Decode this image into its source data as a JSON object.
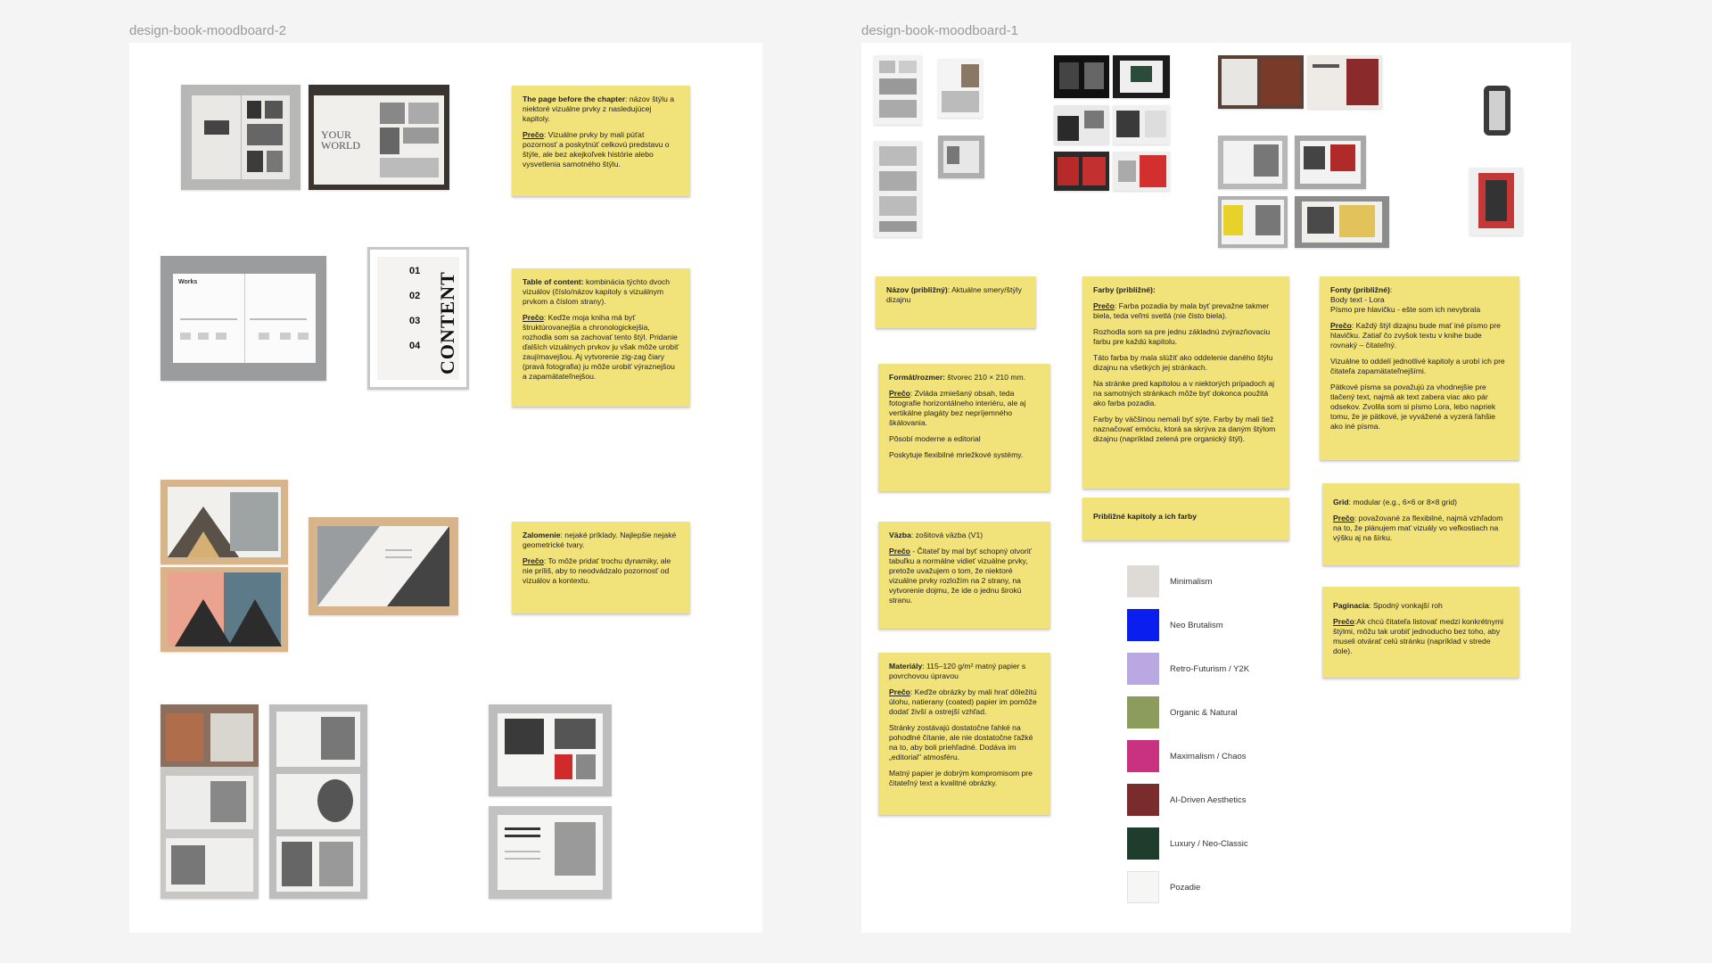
{
  "canvas": {
    "frame_left_title": "design-book-moodboard-2",
    "frame_right_title": "design-book-moodboard-1"
  },
  "left_notes": {
    "chapter": {
      "title": "The page before the chapter",
      "text": ": názov štýlu a niektoré vizuálne prvky z nasledujúcej kapitoly.",
      "why_label": "Prečo",
      "why_text": ": Vizuálne prvky by mali púťat pozornosť a poskytnúť celkovú predstavu o štýle, ale bez akejkoľvek histórie alebo vysvetlenia samotného štýlu."
    },
    "toc": {
      "title": "Table of content:",
      "text": " kombinácia týchto dvoch vizuálov (číslo/názov kapitoly s vizuálnym prvkom a číslom strany).",
      "why_label": "Prečo",
      "why_text": ": Keďže moja kniha má byť štruktúrovanejšia a chronologickejšia, rozhodla som sa zachovať tento štýl. Pridanie ďalších vizuálnych prvkov ju však môže urobiť zaujímavejšou. Aj vytvorenie zig-zag čiary (pravá fotografia) ju môže urobiť výraznejšou a zapamätateľnejšou."
    },
    "fold": {
      "title": "Zalomenie",
      "text": ": nejaké príklady. Najlepšie nejaké geometrické tvary.",
      "why_label": "Prečo",
      "why_text": ": To môže pridať trochu dynamiky, ale nie príliš, aby to neodvádzalo pozornosť od vizuálov a kontextu."
    }
  },
  "right_notes": {
    "name": {
      "title": "Názov (približný)",
      "text": ": Aktuálne smery/štýly dizajnu"
    },
    "format": {
      "title": "Formát/rozmer:",
      "text": " štvorec 210 × 210 mm.",
      "why_label": "Prečo",
      "why_text": ": Zvláda zmiešaný obsah, teda fotografie horizontálneho interiéru, ale aj vertikálne plagáty bez nepríjemného škálovania.",
      "p2": "Pôsobí moderne a editorial",
      "p3": "Poskytuje flexibilné mriežkové systémy."
    },
    "binding": {
      "title": "Väzba",
      "text": ": zošitová väzba (V1)",
      "why_label": "Prečo",
      "why_text": " - Čitateľ by mal byť schopný otvoriť tabuľku a normálne vidieť vizuálne prvky, pretože uvažujem o tom, že niektoré vizuálne prvky rozložím na 2 strany, na vytvorenie dojmu, že ide o jednu širokú stranu."
    },
    "materials": {
      "title": "Materiály",
      "text": ": 115–120 g/m² matný papier s povrchovou úpravou",
      "why_label": "Prečo",
      "why_text": ": Keďže obrázky by mali hrať dôležitú úlohu, natierany (coated) papier im pomôže dodať živší a ostrejší vzhľad.",
      "p2": "Stránky zostávajú dostatočne ľahké na pohodlné čítanie, ale nie dostatočne ťažké na to, aby boli priehľadné. Dodáva im „editorial\" atmosféru.",
      "p3": "Matný papier je dobrým kompromisom pre čitateľný text a kvalitné obrázky."
    },
    "colors": {
      "title": "Farby (približné):",
      "why_label": "Prečo",
      "why_text": ": Farba pozadia by mala byť prevažne takmer biela, teda veľmi svetlá (nie čisto biela).",
      "p2": "Rozhodla som sa pre jednu základnú zvýrazňovaciu farbu pre každú kapitolu.",
      "p3": "Táto farba by mala slúžiť ako oddelenie daného štýlu dizajnu na všetkých jej stránkach.",
      "p4": "Na stránke pred kapitolou a v niektorých prípadoch aj na samotných stránkach môže byť dokonca použitá ako farba pozadia.",
      "p5": "Farby by väčšinou nemali byť sýte. Farby by mali tiež naznačovať emóciu, ktorá sa skrýva za daným štýlom dizajnu (napríklad zelená pre organický štýl)."
    },
    "chapters_colors": {
      "title": "Približné kapitoly a ich farby"
    },
    "fonts": {
      "title": "Fonty (približné)",
      "line1": "Body text - Lora",
      "line2": "Písmo pre hlavičku - ešte som ich nevybrala",
      "why_label": "Prečo",
      "why_text": ": Každý štýl dizajnu bude mať iné písmo pre hlavičku. Zatiaľ čo zvyšok textu v knihe bude rovnaký – čitateľný.",
      "p2": "Vizuálne to oddelí jednotlivé kapitoly a urobí ich pre čitateľa zapamätateľnejšími.",
      "p3": "Pätkové písma sa považujú za vhodnejšie pre tlačený text, najmä ak text zabera viac ako pár odsekov. Zvolila som si písmo Lora, lebo napriek tomu, že je pätkové, je vyvážené a vyzerá ľahšie ako iné písma."
    },
    "grid": {
      "title": "Grid",
      "text": ": modular (e.g., 6×6 or 8×8 grid)",
      "why_label": "Prečo",
      "why_text": ": považované za flexibilné, najmä vzhľadom na to, že plánujem mať vizuály vo veľkostiach na výšku aj na šírku."
    },
    "pagination": {
      "title": "Paginacia",
      "text": ": Spodný vonkajší roh",
      "why_label": "Prečo",
      "why_text": ":Ak chcú čitateľa listovať medzi konkrétnymi štýlmi, môžu tak urobiť jednoducho bez toho, aby museli otvárať celú stránku (napríklad v strede dole)."
    }
  },
  "swatches": [
    {
      "label": "Minimalism",
      "color": "#dedbd6"
    },
    {
      "label": "Neo Brutalism",
      "color": "#0a1ef0"
    },
    {
      "label": "Retro-Futurism / Y2K",
      "color": "#b9a8e2"
    },
    {
      "label": "Organic & Natural",
      "color": "#8c9c5c"
    },
    {
      "label": "Maximalism / Chaos",
      "color": "#c8327e"
    },
    {
      "label": "AI-Driven Aesthetics",
      "color": "#7a2c2c"
    },
    {
      "label": "Luxury / Neo-Classic",
      "color": "#1f3d2c"
    },
    {
      "label": "Pozadie",
      "color": "#f6f6f4"
    }
  ],
  "image_text": {
    "toc_heading": "CONTENT",
    "toc_num_1": "01",
    "toc_num_2": "02",
    "toc_num_3": "03",
    "toc_num_4": "04",
    "works_title": "Works",
    "book_title": "YOUR WORLD"
  }
}
